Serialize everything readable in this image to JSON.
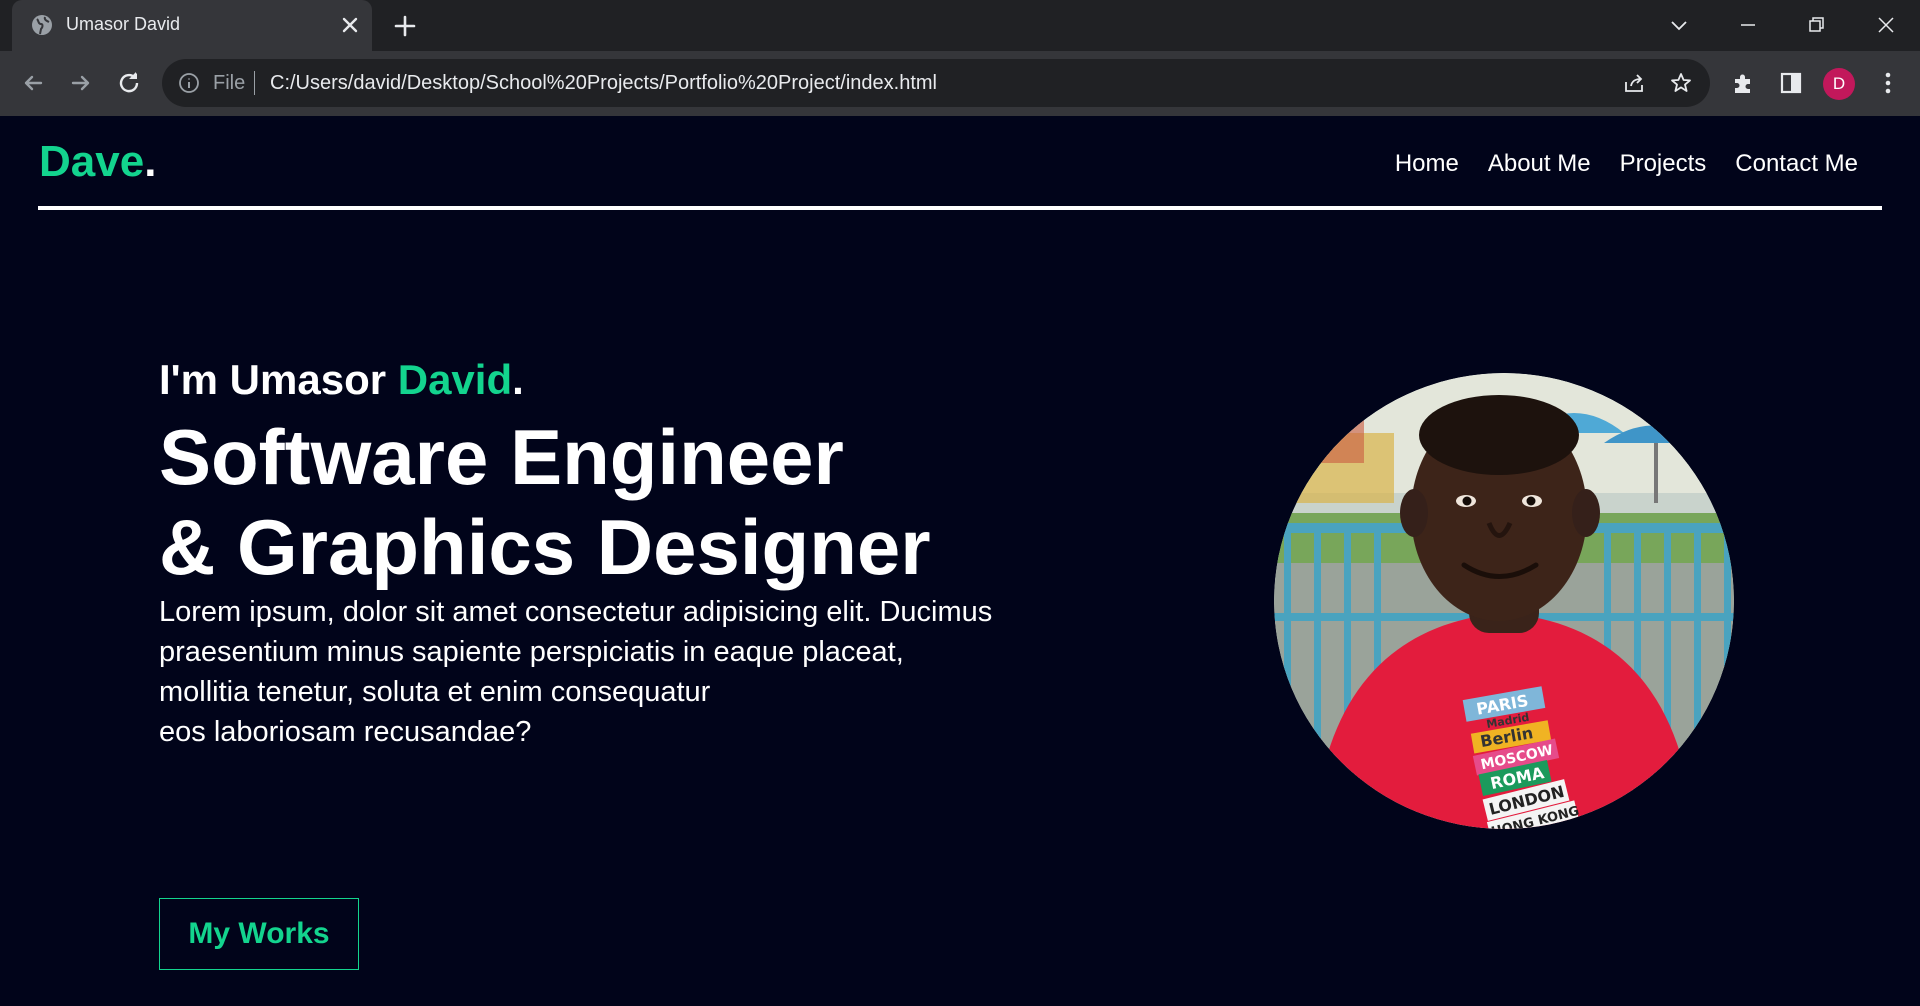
{
  "browser": {
    "tab_title": "Umasor David",
    "file_label": "File",
    "url": "C:/Users/david/Desktop/School%20Projects/Portfolio%20Project/index.html",
    "profile_initial": "D",
    "profile_color": "#c2185b"
  },
  "site": {
    "logo_text": "Dave",
    "logo_dot": ".",
    "accent_color": "#13d48e",
    "background_color": "#01041a",
    "nav": [
      "Home",
      "About Me",
      "Projects",
      "Contact Me"
    ]
  },
  "hero": {
    "intro_prefix": "I'm Umasor ",
    "intro_name": "David",
    "intro_suffix": ".",
    "headline_line1": "Software Engineer",
    "headline_line2": "& Graphics Designer",
    "blurb_lines": [
      "Lorem ipsum, dolor sit amet consectetur adipisicing elit. Ducimus",
      "praesentium minus sapiente perspiciatis in eaque placeat,",
      "mollitia tenetur, soluta et enim consequatur",
      "eos laboriosam recusandae?"
    ],
    "cta_label": "My Works"
  },
  "portrait": {
    "shirt_print_lines": [
      "PARIS",
      "Madrid",
      "Berlin",
      "MOSCOW",
      "ROMA",
      "LONDON",
      "HONG KONG"
    ]
  }
}
